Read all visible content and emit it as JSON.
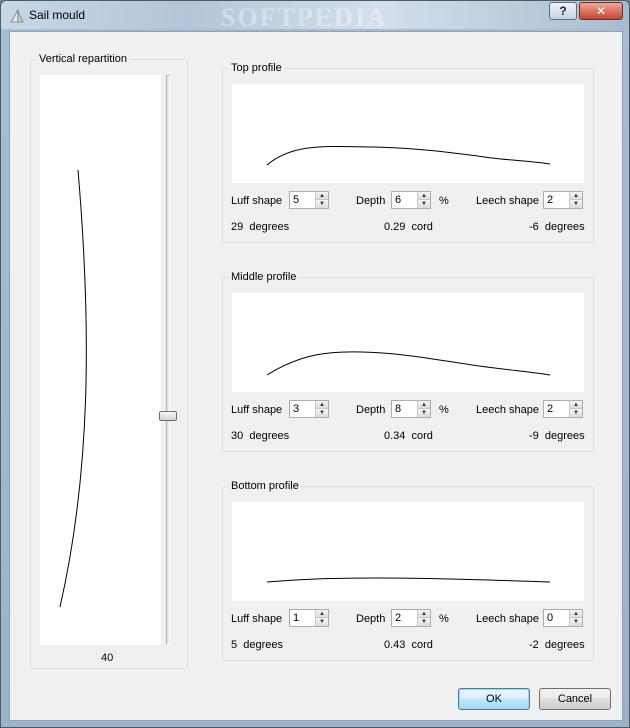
{
  "window": {
    "title": "Sail mould",
    "watermark": "SOFTPEDIA",
    "help_label": "?",
    "close_label": "✕"
  },
  "vertical": {
    "label": "Vertical repartition",
    "value": "40",
    "slider_fraction": 0.4
  },
  "profiles": [
    {
      "label": "Top profile",
      "luff_label": "Luff shape",
      "luff_value": "5",
      "depth_label": "Depth",
      "depth_value": "6",
      "depth_unit": "%",
      "leech_label": "Leech shape",
      "leech_value": "2",
      "luff_readout": "29  degrees",
      "depth_readout": "0.29  cord",
      "leech_readout": "-6  degrees"
    },
    {
      "label": "Middle profile",
      "luff_label": "Luff shape",
      "luff_value": "3",
      "depth_label": "Depth",
      "depth_value": "8",
      "depth_unit": "%",
      "leech_label": "Leech shape",
      "leech_value": "2",
      "luff_readout": "30  degrees",
      "depth_readout": "0.34  cord",
      "leech_readout": "-9  degrees"
    },
    {
      "label": "Bottom profile",
      "luff_label": "Luff shape",
      "luff_value": "1",
      "depth_label": "Depth",
      "depth_value": "2",
      "depth_unit": "%",
      "leech_label": "Leech shape",
      "leech_value": "0",
      "luff_readout": "5  degrees",
      "depth_readout": "0.43  cord",
      "leech_readout": "-2  degrees"
    }
  ],
  "buttons": {
    "ok_label": "OK",
    "cancel_label": "Cancel"
  },
  "colors": {
    "client_bg": "#f0f0f0",
    "default_button_border": "#3c7fb1"
  }
}
